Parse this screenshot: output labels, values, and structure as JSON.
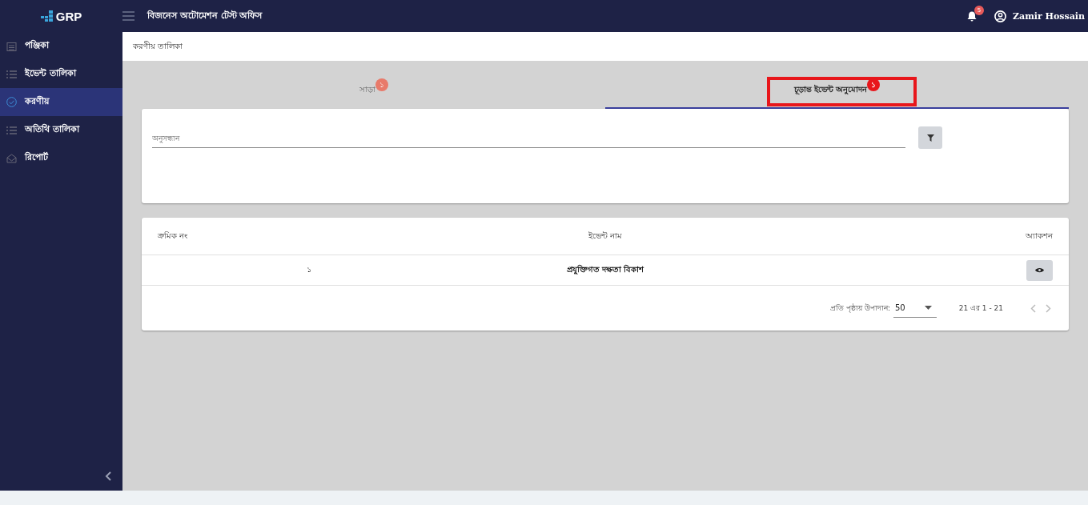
{
  "header": {
    "logo": "GRP",
    "title": "বিজনেস অটোমেশন টেস্ট অফিস",
    "notification_count": "5",
    "user": "Zamir Hossain"
  },
  "sidebar": {
    "items": [
      {
        "label": "পঞ্জিকা",
        "kind": "calendar",
        "selected": false
      },
      {
        "label": "ইভেন্ট তালিকা",
        "kind": "list",
        "selected": false
      },
      {
        "label": "করণীয়",
        "kind": "check",
        "selected": true
      },
      {
        "label": "অতিথি তালিকা",
        "kind": "list",
        "selected": false
      },
      {
        "label": "রিপোর্ট",
        "kind": "mail",
        "selected": false
      }
    ]
  },
  "breadcrumb": "করণীয় তালিকা",
  "tabs": [
    {
      "label": "সাড়া",
      "badge": "১",
      "selected": false,
      "highlighted": false
    },
    {
      "label": "চূড়ান্ত ইভেন্ট অনুমোদন",
      "badge": "১",
      "selected": true,
      "highlighted": true
    }
  ],
  "search": {
    "placeholder": "অনুসন্ধান"
  },
  "table": {
    "columns": [
      "ক্রমিক নং",
      "ইভেন্ট নাম",
      "অ্যাকশন"
    ],
    "rows": [
      {
        "serial": "১",
        "name": "প্রযুক্তিগত দক্ষতা বিকাশ"
      }
    ]
  },
  "pagination": {
    "label": "প্রতি পৃষ্ঠায় উপাদান:",
    "page_size": "50",
    "range": "21 এর 1 - 21"
  }
}
